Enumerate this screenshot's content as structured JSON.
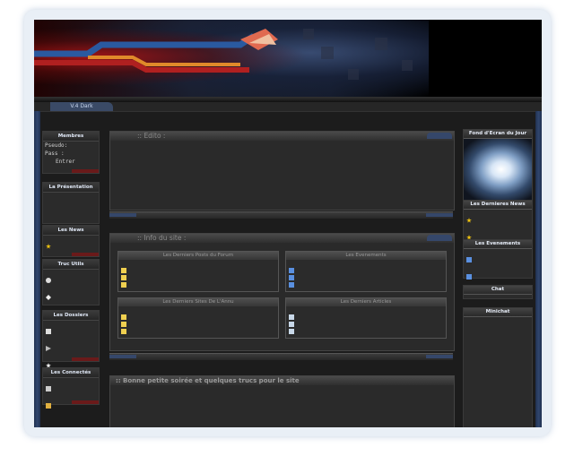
{
  "header": {
    "version": "V.4  Dark"
  },
  "left": {
    "membres": {
      "title": "Membres",
      "pseudo_label": "Pseudo:",
      "pass_label": "Pass    :",
      "enter": "Entrer"
    },
    "presentation": {
      "title": "La Présentation"
    },
    "news": {
      "title": "Les News"
    },
    "trucs": {
      "title": "Truc Utils"
    },
    "dossiers": {
      "title": "Les Dossiers"
    },
    "connectes": {
      "title": "Les Connectés"
    }
  },
  "center": {
    "edito": {
      "title": ":: Edito :"
    },
    "info": {
      "title": ":: Info du site :",
      "posts": "Les Derniers Posts du Forum",
      "events": "Les Evenements",
      "sites": "Les Derniers Sites De L'Annu",
      "articles": "Les Derniers Articles"
    },
    "message": {
      "title": ":: Bonne petite soirée et quelques trucs pour le site"
    }
  },
  "right": {
    "wallpaper": "Fond d'Ecran du Jour",
    "news": "Les Dernieres News",
    "events": "Les Evenements",
    "chat": "Chat",
    "minichat": "Minichat"
  }
}
